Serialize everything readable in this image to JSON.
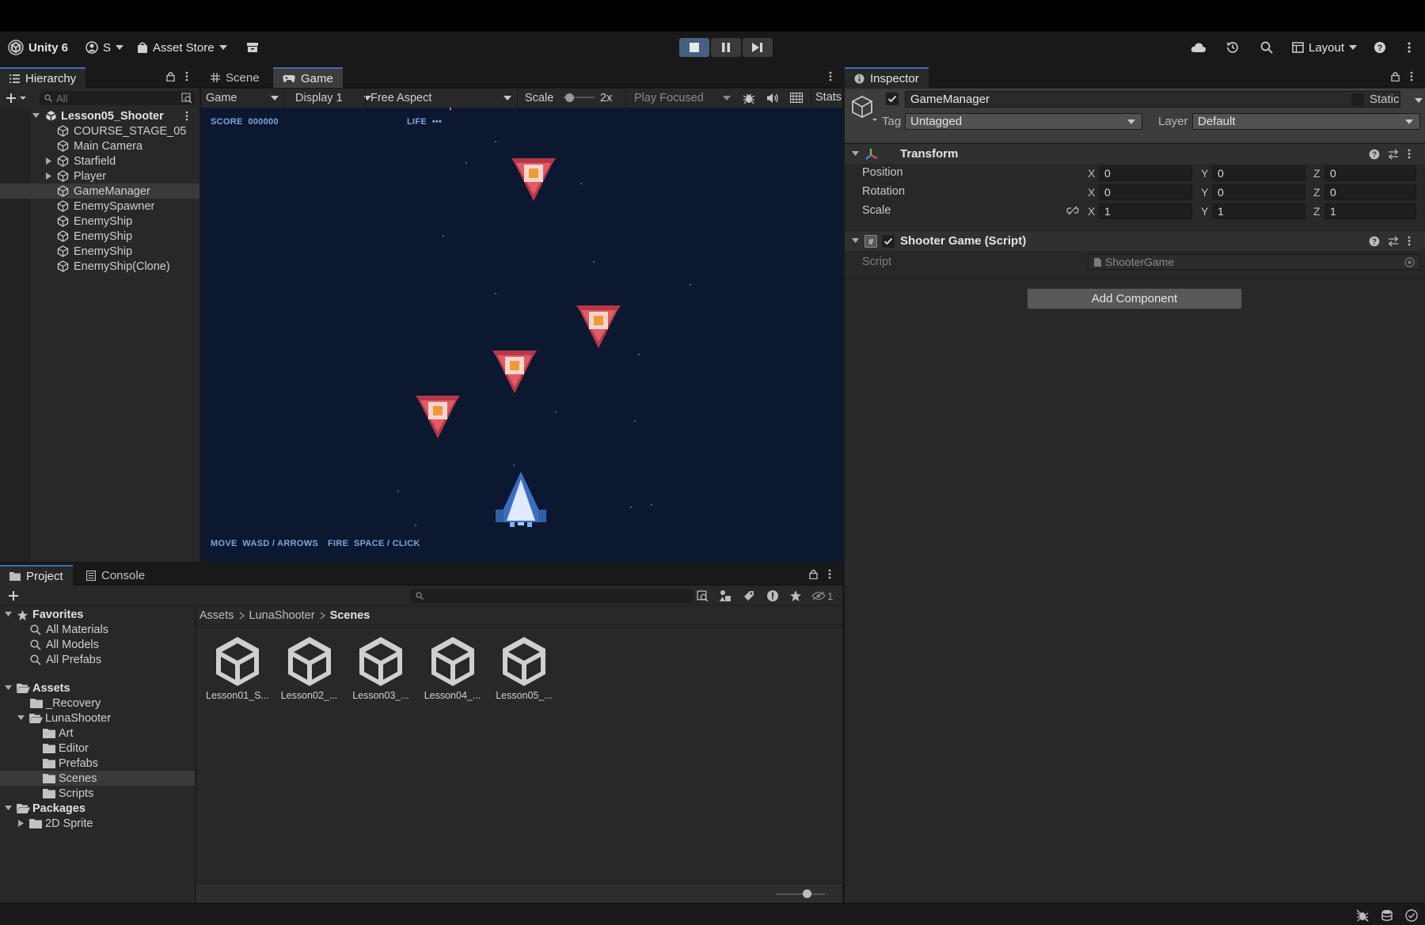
{
  "toolbar": {
    "app_name": "Unity 6",
    "account_initial": "S",
    "asset_store": "Asset Store",
    "layout": "Layout"
  },
  "hierarchy": {
    "tab": "Hierarchy",
    "search_placeholder": "All",
    "scene_name": "Lesson05_Shooter",
    "items": [
      {
        "label": "COURSE_STAGE_05",
        "expandable": false
      },
      {
        "label": "Main Camera",
        "expandable": false
      },
      {
        "label": "Starfield",
        "expandable": true
      },
      {
        "label": "Player",
        "expandable": true
      },
      {
        "label": "GameManager",
        "expandable": false,
        "selected": true
      },
      {
        "label": "EnemySpawner",
        "expandable": false
      },
      {
        "label": "EnemyShip",
        "expandable": false
      },
      {
        "label": "EnemyShip",
        "expandable": false
      },
      {
        "label": "EnemyShip",
        "expandable": false
      },
      {
        "label": "EnemyShip(Clone)",
        "expandable": false
      }
    ]
  },
  "game_view": {
    "tabs": [
      "Scene",
      "Game"
    ],
    "active_tab": "Game",
    "mode": "Game",
    "display": "Display 1",
    "aspect": "Free Aspect",
    "scale_label": "Scale",
    "scale_value": "2x",
    "play_focus": "Play Focused",
    "stats": "Stats",
    "hud_score": "SCORE  000000",
    "hud_life": "LIFE  •••",
    "hud_move": "MOVE  WASD / ARROWS",
    "hud_fire": "FIRE  SPACE / CLICK"
  },
  "inspector": {
    "tab": "Inspector",
    "object_name": "GameManager",
    "static_label": "Static",
    "tag_label": "Tag",
    "tag_value": "Untagged",
    "layer_label": "Layer",
    "layer_value": "Default",
    "transform": {
      "title": "Transform",
      "rows": [
        {
          "label": "Position",
          "x": "0",
          "y": "0",
          "z": "0"
        },
        {
          "label": "Rotation",
          "x": "0",
          "y": "0",
          "z": "0"
        },
        {
          "label": "Scale",
          "x": "1",
          "y": "1",
          "z": "1"
        }
      ]
    },
    "script_component": {
      "title": "Shooter Game (Script)",
      "script_label": "Script",
      "script_value": "ShooterGame"
    },
    "add_component": "Add Component"
  },
  "project": {
    "tabs": [
      "Project",
      "Console"
    ],
    "hidden_count": "1",
    "breadcrumb": [
      "Assets",
      "LunaShooter",
      "Scenes"
    ],
    "favorites": {
      "label": "Favorites",
      "items": [
        "All Materials",
        "All Models",
        "All Prefabs"
      ]
    },
    "assets_root": "Assets",
    "recovery": "_Recovery",
    "luna": "LunaShooter",
    "luna_children": [
      "Art",
      "Editor",
      "Prefabs",
      "Scenes",
      "Scripts"
    ],
    "selected_folder": "Scenes",
    "packages": "Packages",
    "package_items": [
      "2D Sprite"
    ],
    "assets": [
      "Lesson01_S...",
      "Lesson02_...",
      "Lesson03_...",
      "Lesson04_...",
      "Lesson05_..."
    ]
  },
  "colors": {
    "accent": "#3c6eb4",
    "game_bg": "#0b1830",
    "enemy": "#d9525c",
    "player": "#dfe9ff"
  }
}
